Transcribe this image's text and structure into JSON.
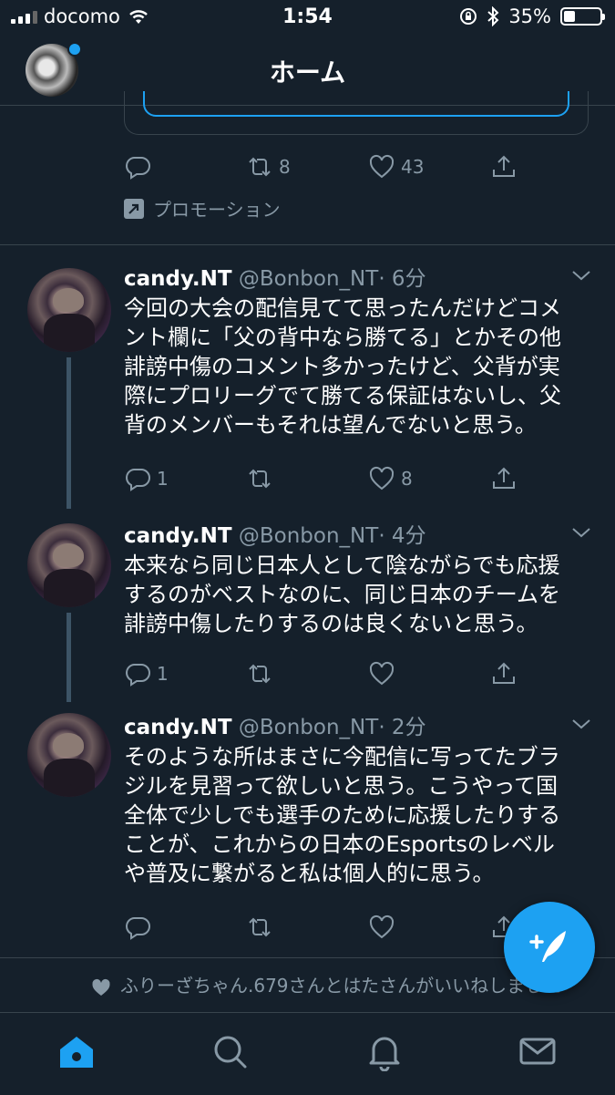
{
  "status_bar": {
    "carrier": "docomo",
    "time": "1:54",
    "battery": "35%",
    "battery_level": 0.35
  },
  "header": {
    "title": "ホーム"
  },
  "promoted_tweet": {
    "retweets": "8",
    "likes": "43",
    "promo_label": "プロモーション"
  },
  "tweets": [
    {
      "name": "candy.NT",
      "handle": "@Bonbon_NT",
      "time": "· 6分",
      "lines": [
        "今回の大会の配信見てて思ったんだけどコメ",
        "ント欄に「父の背中なら勝てる」とかその他",
        "誹謗中傷のコメント多かったけど、父背が実",
        "際にプロリーグでて勝てる保証はないし、父",
        "背のメンバーもそれは望んでないと思う。"
      ],
      "replies": "1",
      "retweets": "",
      "likes": "8"
    },
    {
      "name": "candy.NT",
      "handle": "@Bonbon_NT",
      "time": "· 4分",
      "lines": [
        "本来なら同じ日本人として陰ながらでも応援",
        "するのがベストなのに、同じ日本のチームを",
        "誹謗中傷したりするのは良くないと思う。"
      ],
      "replies": "1",
      "retweets": "",
      "likes": ""
    },
    {
      "name": "candy.NT",
      "handle": "@Bonbon_NT",
      "time": "· 2分",
      "lines": [
        "そのような所はまさに今配信に写ってたブラ",
        "ジルを見習って欲しいと思う。こうやって国",
        "全体で少しでも選手のために応援したりする",
        "ことが、これからの日本のEsportsのレベル",
        "や普及に繋がると私は個人的に思う。"
      ],
      "replies": "",
      "retweets": "",
      "likes": ""
    }
  ],
  "liked_notice": {
    "text": "ふりーざちゃん.679さんとはたさんがいいねしました"
  },
  "tabs": [
    "home-icon",
    "search-icon",
    "bell-icon",
    "mail-icon"
  ],
  "colors": {
    "background": "#15202b",
    "accent": "#1da1f2",
    "muted": "#8899a6",
    "divider": "#38444d"
  }
}
